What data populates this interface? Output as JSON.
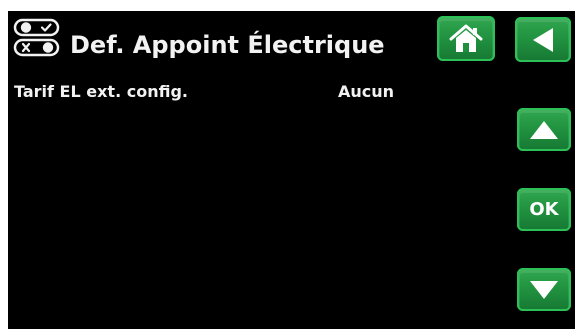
{
  "header": {
    "title": "Def. Appoint Électrique",
    "icon": "toggle-switches-icon"
  },
  "settings": {
    "rows": [
      {
        "label": "Tarif EL ext. config.",
        "value": "Aucun"
      }
    ]
  },
  "buttons": {
    "home_icon": "home-icon",
    "back_icon": "back-arrow-icon",
    "up_icon": "up-arrow-icon",
    "ok_label": "OK",
    "down_icon": "down-arrow-icon"
  },
  "colors": {
    "screen_background": "#000000",
    "button_green": "#1f8f3e",
    "text": "#f2f2f2"
  }
}
